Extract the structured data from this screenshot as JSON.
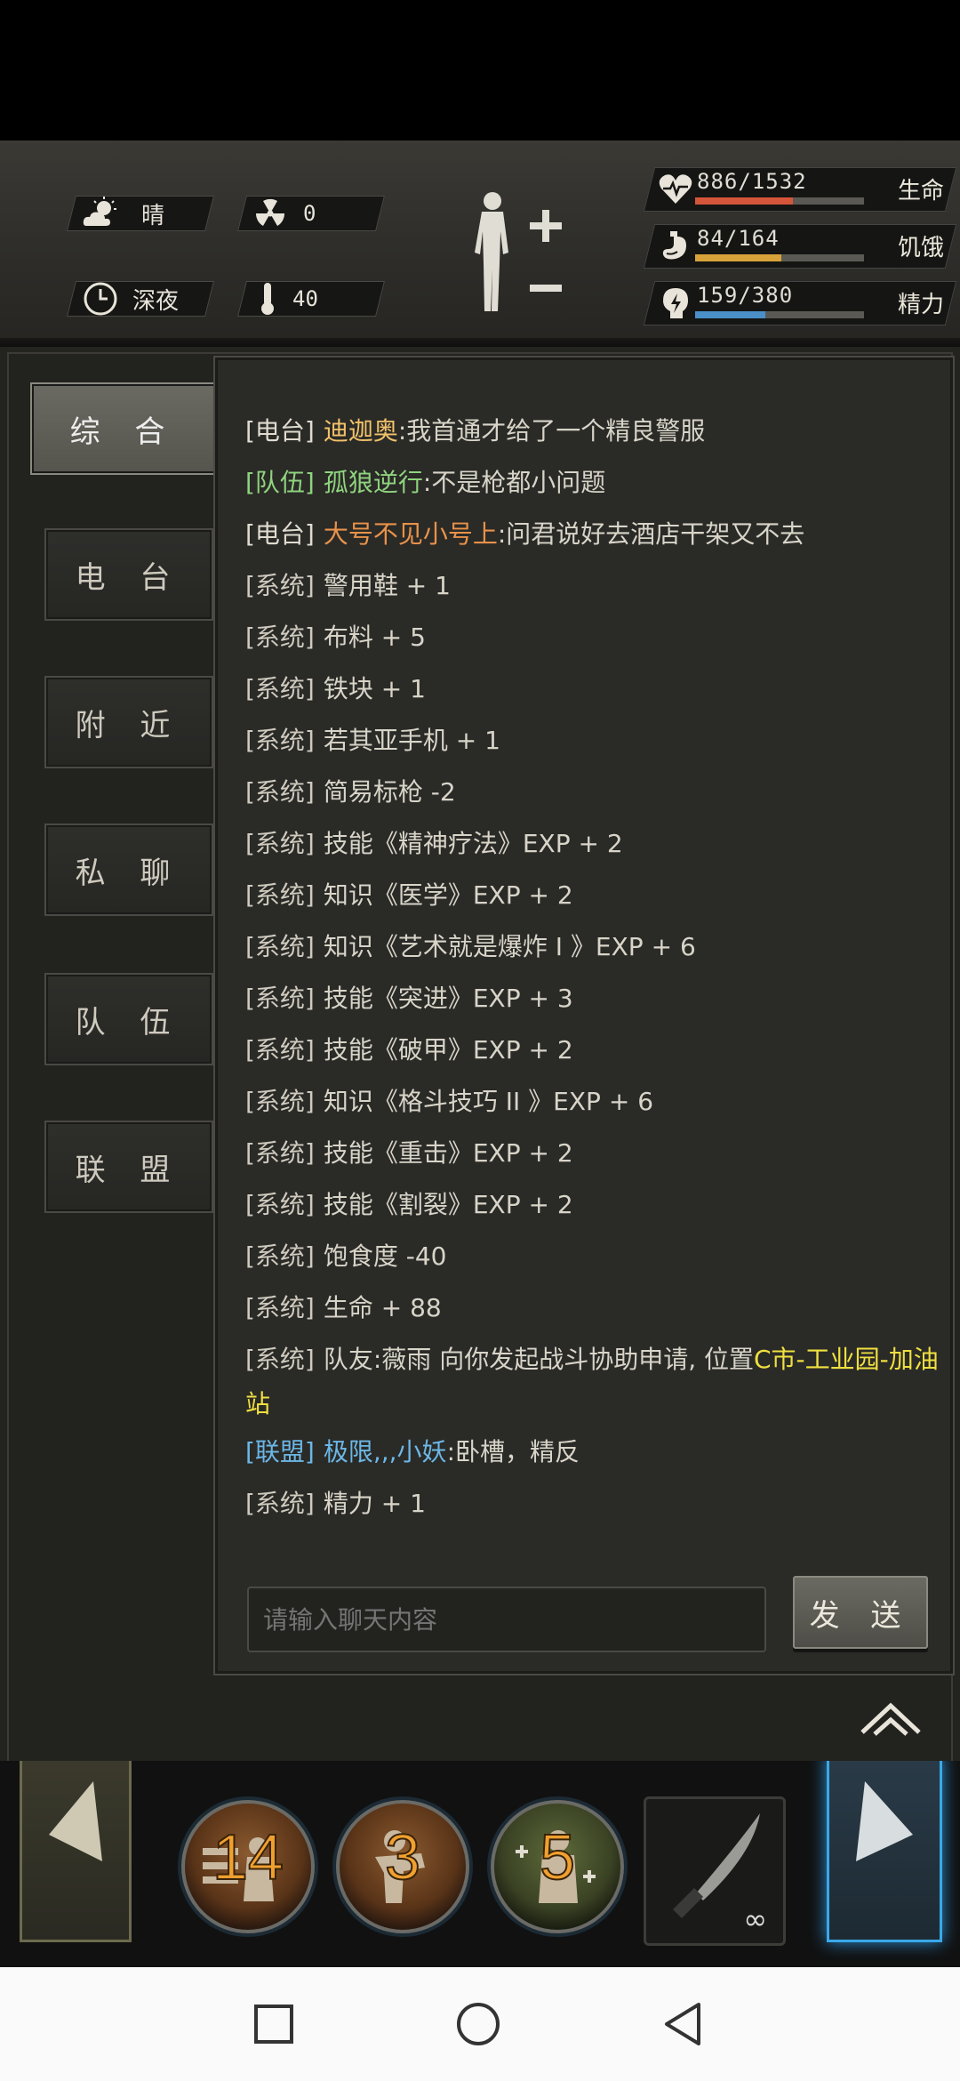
{
  "status": {
    "weather": "晴",
    "radiation": "0",
    "time_of_day": "深夜",
    "temperature": "40"
  },
  "vitals": [
    {
      "value": "886/1532",
      "label": "生命",
      "fraction": 0.578,
      "color": "#d4553a",
      "icon": "heart-icon"
    },
    {
      "value": "84/164",
      "label": "饥饿",
      "fraction": 0.512,
      "color": "#d8a23a",
      "icon": "stomach-icon"
    },
    {
      "value": "159/380",
      "label": "精力",
      "fraction": 0.418,
      "color": "#4a8fc8",
      "icon": "energy-icon"
    }
  ],
  "tabs": [
    "综 合",
    "电 台",
    "附 近",
    "私 聊",
    "队 伍",
    "联 盟"
  ],
  "chat": {
    "messages": [
      {
        "channel": "[电台]",
        "type": "radio",
        "name": "迪迦奥",
        "name_color": "#f2c26a",
        "text": ":我首通才给了一个精良警服"
      },
      {
        "channel": "[队伍]",
        "type": "team",
        "name": "孤狼逆行",
        "name_color": "#8fd37e",
        "text": ":不是枪都小问题"
      },
      {
        "channel": "[电台]",
        "type": "radio",
        "name": "大号不见小号上",
        "name_color": "#e8924a",
        "text": ":问君说好去酒店干架又不去"
      },
      {
        "channel": "[系统]",
        "type": "sys",
        "text": "警用鞋 + 1"
      },
      {
        "channel": "[系统]",
        "type": "sys",
        "text": "布料 + 5"
      },
      {
        "channel": "[系统]",
        "type": "sys",
        "text": "铁块 + 1"
      },
      {
        "channel": "[系统]",
        "type": "sys",
        "text": "若其亚手机 + 1"
      },
      {
        "channel": "[系统]",
        "type": "sys",
        "text": "简易标枪 -2"
      },
      {
        "channel": "[系统]",
        "type": "sys",
        "text": "技能《精神疗法》EXP + 2"
      },
      {
        "channel": "[系统]",
        "type": "sys",
        "text": "知识《医学》EXP + 2"
      },
      {
        "channel": "[系统]",
        "type": "sys",
        "text": "知识《艺术就是爆炸 I 》EXP + 6"
      },
      {
        "channel": "[系统]",
        "type": "sys",
        "text": "技能《突进》EXP + 3"
      },
      {
        "channel": "[系统]",
        "type": "sys",
        "text": "技能《破甲》EXP + 2"
      },
      {
        "channel": "[系统]",
        "type": "sys",
        "text": "知识《格斗技巧 II 》EXP + 6"
      },
      {
        "channel": "[系统]",
        "type": "sys",
        "text": "技能《重击》EXP + 2"
      },
      {
        "channel": "[系统]",
        "type": "sys",
        "text": "技能《割裂》EXP + 2"
      },
      {
        "channel": "[系统]",
        "type": "sys",
        "text": "饱食度 -40"
      },
      {
        "channel": "[系统]",
        "type": "sys",
        "text": "生命 + 88"
      },
      {
        "channel": "[系统]",
        "type": "sys",
        "text": "队友:薇雨 向你发起战斗协助申请, 位置",
        "highlight": "C市-工业园-加油站",
        "highlight_color": "#f0e040",
        "wrap": true
      },
      {
        "channel": "[联盟]",
        "type": "alliance",
        "name": "极限,,,小妖",
        "name_color": "#6cb7e6",
        "text": ":卧槽，精反"
      },
      {
        "channel": "[系统]",
        "type": "sys",
        "text": "精力 + 1"
      }
    ],
    "input_placeholder": "请输入聊天内容",
    "send_label": "发 送"
  },
  "hotbar": {
    "slots": [
      {
        "count": "14",
        "icon": "barricade-icon"
      },
      {
        "count": "3",
        "icon": "punch-icon"
      },
      {
        "count": "5",
        "icon": "heal-icon"
      }
    ],
    "weapon": {
      "icon": "knife-icon",
      "count": "∞"
    }
  }
}
